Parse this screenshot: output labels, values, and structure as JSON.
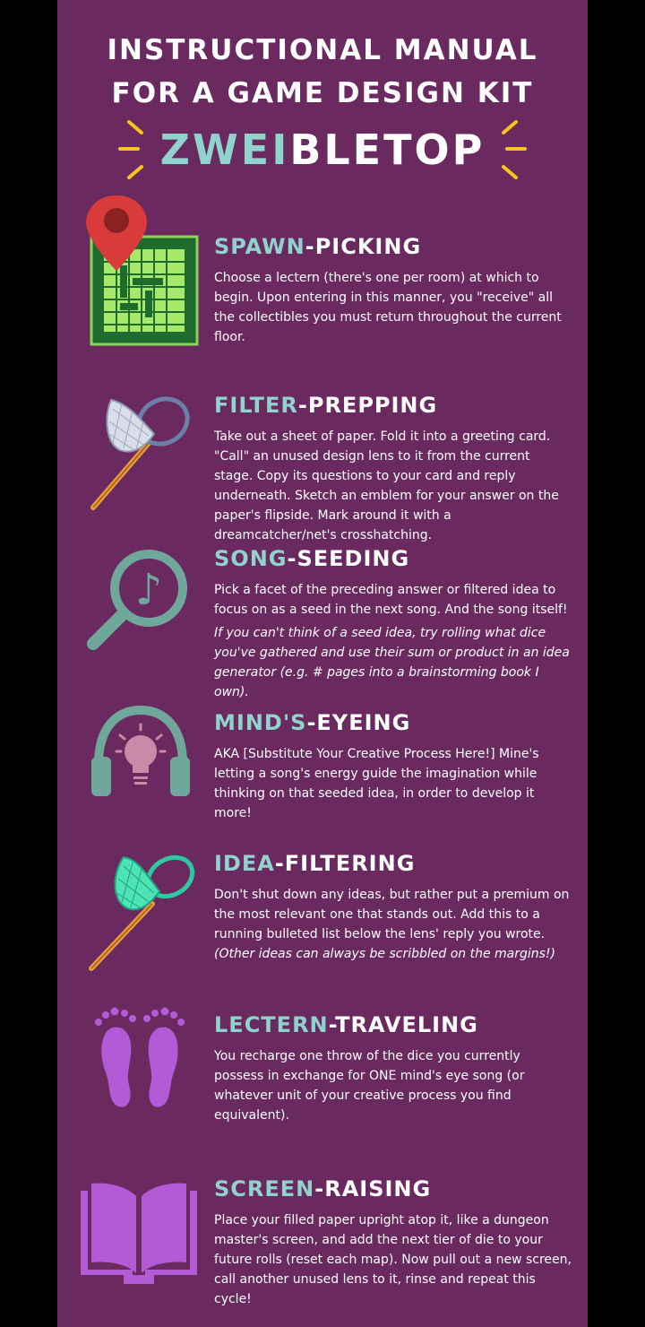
{
  "header": {
    "line1": "INSTRUCTIONAL MANUAL",
    "line2": "FOR A GAME DESIGN KIT",
    "brand_a": "ZWEI",
    "brand_b": "BLETOP"
  },
  "colors": {
    "background": "#6b2a5f",
    "accent": "#8fd3cc",
    "ray": "#f5c518",
    "purple_icon": "#b35ad6"
  },
  "sections": [
    {
      "key": "SPAWN",
      "rest": "-PICKING",
      "icon": "map-pin-grid-icon",
      "body": "Choose a lectern (there's one per room) at which to begin. Upon entering in this manner, you \"receive\" all the collectibles you must return throughout the current floor."
    },
    {
      "key": "FILTER",
      "rest": "-PREPPING",
      "icon": "net-icon",
      "body": "Take out a sheet of paper. Fold it into a greeting card. \"Call\" an unused design lens to it from the current stage. Copy its questions to your card and reply underneath. Sketch an emblem for your answer on the paper's flipside. Mark around it with a dreamcatcher/net's crosshatching."
    },
    {
      "key": "SONG",
      "rest": "-SEEDING",
      "icon": "music-search-icon",
      "body": "Pick a facet of the preceding answer or filtered idea to focus on as a seed in the next song. And the song itself!",
      "note": "If you can't think of a seed idea, try rolling what dice you've gathered and use their sum or product in an idea generator (e.g. # pages into a brainstorming book I own)."
    },
    {
      "key": "MIND'S",
      "rest": "-EYEING",
      "icon": "headphones-bulb-icon",
      "body": "AKA [Substitute Your Creative Process Here!] Mine's letting a song's energy guide the imagination while thinking on that seeded idea, in order to develop it more!"
    },
    {
      "key": "IDEA",
      "rest": "-FILTERING",
      "icon": "green-net-icon",
      "body": "Don't shut down any ideas, but rather put a premium on the most relevant one that stands out. Add this to a running bulleted list below the lens' reply you wrote.",
      "note": "(Other ideas can always be scribbled on the margins!)"
    },
    {
      "key": "LECTERN",
      "rest": "-TRAVELING",
      "icon": "footprints-icon",
      "body": "You recharge one throw of the dice you currently possess in exchange for ONE mind's eye song (or whatever unit of your creative process you find equivalent)."
    },
    {
      "key": "SCREEN",
      "rest": "-RAISING",
      "icon": "open-book-icon",
      "body": "Place your filled paper upright atop it, like a dungeon master's screen, and add the next tier of die to your future rolls (reset each map). Now pull out a new screen, call another unused lens to it, rinse and repeat this cycle!"
    }
  ]
}
